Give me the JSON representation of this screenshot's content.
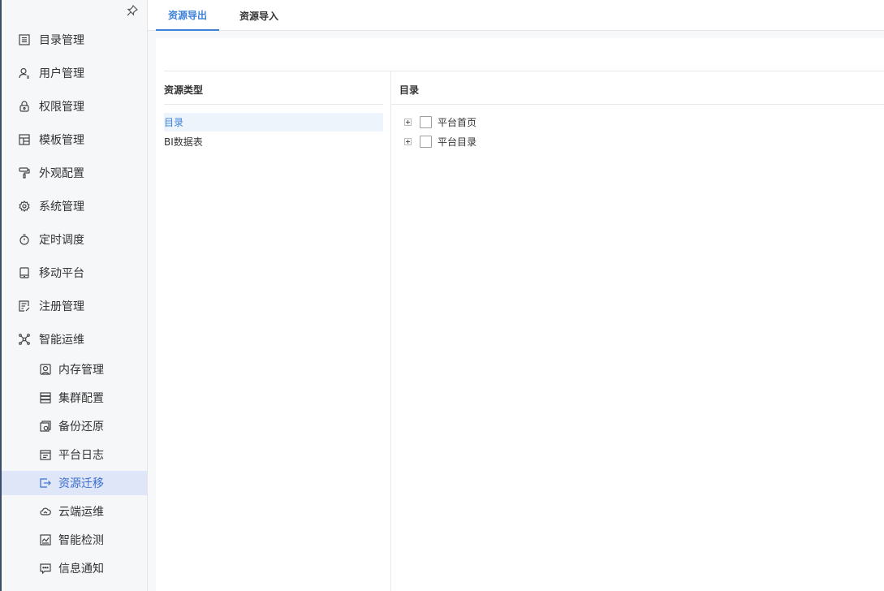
{
  "colors": {
    "accent": "#3d82d6",
    "sidebar_active_bg": "#dee6f7",
    "sidebar_bg": "#f6f7f9"
  },
  "sidebar": {
    "pin_icon": "pin-icon",
    "items": [
      {
        "label": "目录管理",
        "icon": "catalog-icon"
      },
      {
        "label": "用户管理",
        "icon": "user-icon"
      },
      {
        "label": "权限管理",
        "icon": "lock-icon"
      },
      {
        "label": "模板管理",
        "icon": "template-icon"
      },
      {
        "label": "外观配置",
        "icon": "paint-roller-icon"
      },
      {
        "label": "系统管理",
        "icon": "gear-icon"
      },
      {
        "label": "定时调度",
        "icon": "stopwatch-icon"
      },
      {
        "label": "移动平台",
        "icon": "tablet-icon"
      },
      {
        "label": "注册管理",
        "icon": "register-icon"
      },
      {
        "label": "智能运维",
        "icon": "network-icon",
        "expanded": true
      }
    ],
    "sub_items": [
      {
        "label": "内存管理",
        "icon": "memory-icon"
      },
      {
        "label": "集群配置",
        "icon": "server-stack-icon"
      },
      {
        "label": "备份还原",
        "icon": "backup-icon"
      },
      {
        "label": "平台日志",
        "icon": "log-icon"
      },
      {
        "label": "资源迁移",
        "icon": "migrate-icon",
        "active": true
      },
      {
        "label": "云端运维",
        "icon": "cloud-icon"
      },
      {
        "label": "智能检测",
        "icon": "monitor-icon"
      },
      {
        "label": "信息通知",
        "icon": "message-icon"
      }
    ]
  },
  "tabs": [
    {
      "label": "资源导出",
      "active": true
    },
    {
      "label": "资源导入",
      "active": false
    }
  ],
  "left_panel": {
    "title": "资源类型",
    "items": [
      {
        "label": "目录",
        "selected": true
      },
      {
        "label": "BI数据表",
        "selected": false
      }
    ]
  },
  "right_panel": {
    "title": "目录",
    "tree": [
      {
        "label": "平台首页",
        "checked": false
      },
      {
        "label": "平台目录",
        "checked": false
      }
    ]
  }
}
